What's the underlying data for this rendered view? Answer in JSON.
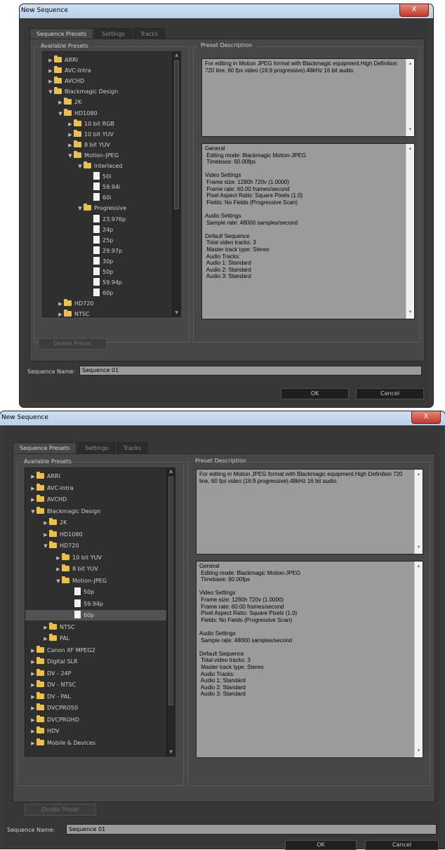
{
  "top": {
    "window_title": "New Sequence",
    "close_label": "X",
    "tabs": [
      "Sequence Presets",
      "Settings",
      "Tracks"
    ],
    "available_presets_label": "Available Presets",
    "tree": [
      {
        "label": "ARRI",
        "icon": "folder-icon",
        "expander": "collapsed"
      },
      {
        "label": "AVC-Intra",
        "icon": "folder-icon",
        "expander": "collapsed"
      },
      {
        "label": "AVCHD",
        "icon": "folder-icon",
        "expander": "collapsed"
      },
      {
        "label": "Blackmagic Design",
        "icon": "folder-icon",
        "expander": "expanded"
      },
      {
        "label": "2K",
        "icon": "folder-icon",
        "expander": "collapsed"
      },
      {
        "label": "HD1080",
        "icon": "folder-icon",
        "expander": "expanded"
      },
      {
        "label": "10 bit RGB",
        "icon": "folder-icon",
        "expander": "collapsed"
      },
      {
        "label": "10 bit YUV",
        "icon": "folder-icon",
        "expander": "collapsed"
      },
      {
        "label": "8 bit YUV",
        "icon": "folder-icon",
        "expander": "collapsed"
      },
      {
        "label": "Motion-JPEG",
        "icon": "folder-icon",
        "expander": "expanded"
      },
      {
        "label": "Interlaced",
        "icon": "folder-icon",
        "expander": "expanded"
      },
      {
        "label": "50i",
        "icon": "preset-file-icon",
        "expander": "none"
      },
      {
        "label": "59.94i",
        "icon": "preset-file-icon",
        "expander": "none"
      },
      {
        "label": "60i",
        "icon": "preset-file-icon",
        "expander": "none"
      },
      {
        "label": "Progressive",
        "icon": "folder-icon",
        "expander": "expanded"
      },
      {
        "label": "23.976p",
        "icon": "preset-file-icon",
        "expander": "none"
      },
      {
        "label": "24p",
        "icon": "preset-file-icon",
        "expander": "none"
      },
      {
        "label": "25p",
        "icon": "preset-file-icon",
        "expander": "none"
      },
      {
        "label": "29.97p",
        "icon": "preset-file-icon",
        "expander": "none"
      },
      {
        "label": "30p",
        "icon": "preset-file-icon",
        "expander": "none"
      },
      {
        "label": "50p",
        "icon": "preset-file-icon",
        "expander": "none"
      },
      {
        "label": "59.94p",
        "icon": "preset-file-icon",
        "expander": "none"
      },
      {
        "label": "60p",
        "icon": "preset-file-icon",
        "expander": "none"
      },
      {
        "label": "HD720",
        "icon": "folder-icon",
        "expander": "collapsed"
      },
      {
        "label": "NTSC",
        "icon": "folder-icon",
        "expander": "collapsed"
      }
    ],
    "preset_description_label": "Preset Description",
    "description": "For editing in Motion JPEG format with Blackmagic equipment.High Definition 720 line, 60 fps video (16:9 progressive).48kHz 16 bit audio.",
    "details": [
      "General",
      " Editing mode: Blackmagic Motion-JPEG",
      " Timebase: 60.00fps",
      "",
      "Video Settings",
      " Frame size: 1280h 720v (1.0000)",
      " Frame rate: 60.00 frames/second",
      " Pixel Aspect Ratio: Square Pixels (1.0)",
      " Fields: No Fields (Progressive Scan)",
      "",
      "Audio Settings",
      " Sample rate: 48000 samples/second",
      "",
      "Default Sequence",
      " Total video tracks: 3",
      " Master track type: Stereo",
      " Audio Tracks:",
      " Audio 1: Standard",
      " Audio 2: Standard",
      " Audio 3: Standard"
    ],
    "delete_preset_label": "Delete Preset",
    "sequence_name_label": "Sequence Name:",
    "sequence_name_value": "Sequence 01",
    "ok_label": "OK",
    "cancel_label": "Cancel"
  },
  "bottom": {
    "window_title": "New Sequence",
    "close_label": "X",
    "tabs": [
      "Sequence Presets",
      "Settings",
      "Tracks"
    ],
    "available_presets_label": "Available Presets",
    "tree": [
      {
        "label": "ARRI",
        "icon": "folder-icon",
        "expander": "collapsed"
      },
      {
        "label": "AVC-Intra",
        "icon": "folder-icon",
        "expander": "collapsed"
      },
      {
        "label": "AVCHD",
        "icon": "folder-icon",
        "expander": "collapsed"
      },
      {
        "label": "Blackmagic Design",
        "icon": "folder-icon",
        "expander": "expanded"
      },
      {
        "label": "2K",
        "icon": "folder-icon",
        "expander": "collapsed"
      },
      {
        "label": "HD1080",
        "icon": "folder-icon",
        "expander": "collapsed"
      },
      {
        "label": "HD720",
        "icon": "folder-icon",
        "expander": "expanded"
      },
      {
        "label": "10 bit YUV",
        "icon": "folder-icon",
        "expander": "collapsed"
      },
      {
        "label": "8 bit YUV",
        "icon": "folder-icon",
        "expander": "collapsed"
      },
      {
        "label": "Motion-JPEG",
        "icon": "folder-icon",
        "expander": "expanded"
      },
      {
        "label": "50p",
        "icon": "preset-file-icon",
        "expander": "none"
      },
      {
        "label": "59.94p",
        "icon": "preset-file-icon",
        "expander": "none"
      },
      {
        "label": "60p",
        "icon": "preset-file-icon",
        "expander": "none",
        "selected": true
      },
      {
        "label": "NTSC",
        "icon": "folder-icon",
        "expander": "collapsed"
      },
      {
        "label": "PAL",
        "icon": "folder-icon",
        "expander": "collapsed"
      },
      {
        "label": "Canon XF MPEG2",
        "icon": "folder-icon",
        "expander": "collapsed"
      },
      {
        "label": "Digital SLR",
        "icon": "folder-icon",
        "expander": "collapsed"
      },
      {
        "label": "DV - 24P",
        "icon": "folder-icon",
        "expander": "collapsed"
      },
      {
        "label": "DV - NTSC",
        "icon": "folder-icon",
        "expander": "collapsed"
      },
      {
        "label": "DV - PAL",
        "icon": "folder-icon",
        "expander": "collapsed"
      },
      {
        "label": "DVCPRO50",
        "icon": "folder-icon",
        "expander": "collapsed"
      },
      {
        "label": "DVCPROHD",
        "icon": "folder-icon",
        "expander": "collapsed"
      },
      {
        "label": "HDV",
        "icon": "folder-icon",
        "expander": "collapsed"
      },
      {
        "label": "Mobile & Devices",
        "icon": "folder-icon",
        "expander": "collapsed"
      }
    ],
    "preset_description_label": "Preset Description",
    "description": "For editing in Motion JPEG format with Blackmagic equipment.High Definition 720 line, 60 fps video (16:9 progressive).48kHz 16 bit audio.",
    "details": [
      "General",
      " Editing mode: Blackmagic Motion-JPEG",
      " Timebase: 60.00fps",
      "",
      "Video Settings",
      " Frame size: 1280h 720v (1.0000)",
      " Frame rate: 60.00 frames/second",
      " Pixel Aspect Ratio: Square Pixels (1.0)",
      " Fields: No Fields (Progressive Scan)",
      "",
      "Audio Settings",
      " Sample rate: 48000 samples/second",
      "",
      "Default Sequence",
      " Total video tracks: 3",
      " Master track type: Stereo",
      " Audio Tracks:",
      " Audio 1: Standard",
      " Audio 2: Standard",
      " Audio 3: Standard"
    ],
    "delete_preset_label": "Delete Preset",
    "sequence_name_label": "Sequence Name:",
    "sequence_name_value": "Sequence 01",
    "ok_label": "OK",
    "cancel_label": "Cancel"
  }
}
